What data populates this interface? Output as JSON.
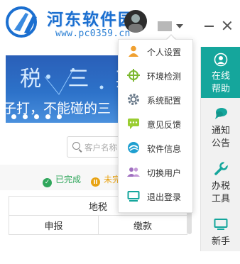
{
  "header": {
    "logo_text": "河东软件园",
    "logo_url": "www.pc0359.cn",
    "window_buttons": [
      "minimize-icon",
      "close-icon"
    ]
  },
  "banner": {
    "line1": "税 三 期",
    "line2": "子打，不能碰的三"
  },
  "search": {
    "placeholder": "客户名称"
  },
  "legend": {
    "done": "已完成",
    "pending": "未完"
  },
  "table": {
    "header": "地税",
    "columns": [
      "申报",
      "缴款"
    ]
  },
  "user_menu": {
    "items": [
      {
        "label": "个人设置",
        "icon": "user-icon",
        "color": "#f0a030"
      },
      {
        "label": "环境检测",
        "icon": "crosshair-icon",
        "color": "#7cb82f"
      },
      {
        "label": "系统配置",
        "icon": "gear-icon",
        "color": "#6a7a8a"
      },
      {
        "label": "意见反馈",
        "icon": "chat-icon",
        "color": "#9acd32"
      },
      {
        "label": "软件信息",
        "icon": "swirl-icon",
        "color": "#1e9fd0"
      },
      {
        "label": "切换用户",
        "icon": "users-icon",
        "color": "#a070c0"
      },
      {
        "label": "退出登录",
        "icon": "monitor-icon",
        "color": "#15a69c"
      }
    ]
  },
  "side_panel": {
    "items": [
      {
        "label_1": "在线",
        "label_2": "帮助",
        "icon": "headset-icon",
        "active": true
      },
      {
        "label_1": "通知",
        "label_2": "公告",
        "icon": "chat-bubble-icon",
        "active": false
      },
      {
        "label_1": "办税",
        "label_2": "工具",
        "icon": "wrench-icon",
        "active": false
      },
      {
        "label_1": "新手",
        "label_2": "",
        "icon": "monitor-icon",
        "active": false
      }
    ],
    "accent": "#15a69c"
  }
}
